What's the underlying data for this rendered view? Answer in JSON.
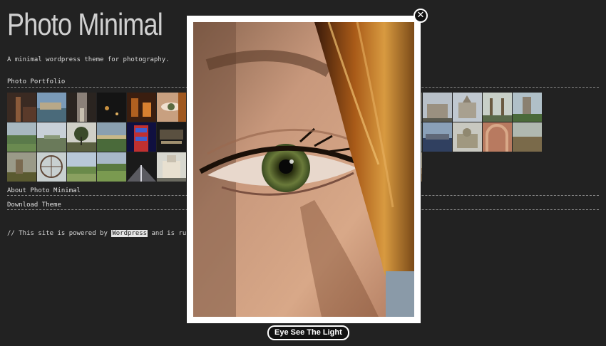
{
  "site": {
    "title": "Photo Minimal",
    "tagline": "A minimal wordpress theme for photography."
  },
  "sections": {
    "portfolio": "Photo Portfolio",
    "about": "About Photo Minimal",
    "download": "Download Theme"
  },
  "footer": {
    "prefix": "// This site is powered by ",
    "link": "Wordpress",
    "suffix": " and is running"
  },
  "lightbox": {
    "caption": "Eye See The Light",
    "close_icon": "close-icon"
  },
  "colors": {
    "background": "#222222",
    "text": "#d9d9d9",
    "frame": "#ffffff",
    "caption_bg": "#111111"
  }
}
